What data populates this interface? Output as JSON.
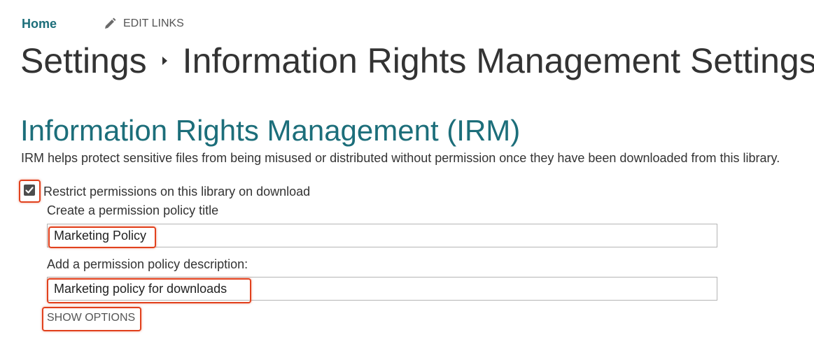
{
  "nav": {
    "home_label": "Home",
    "edit_links_label": "EDIT LINKS"
  },
  "page": {
    "breadcrumb_parent": "Settings",
    "breadcrumb_current": "Information Rights Management Settings"
  },
  "irm": {
    "section_title": "Information Rights Management (IRM)",
    "description": "IRM helps protect sensitive files from being misused or distributed without permission once they have been downloaded from this library.",
    "restrict_checkbox_label": "Restrict permissions on this library on download",
    "restrict_checked": true,
    "policy_title_label": "Create a permission policy title",
    "policy_title_value": "Marketing Policy",
    "policy_description_label": "Add a permission policy description:",
    "policy_description_value": "Marketing policy for downloads",
    "show_options_label": "SHOW OPTIONS"
  },
  "colors": {
    "accent": "#1c6e7a",
    "highlight": "#e1411d",
    "text": "#333333"
  },
  "icons": {
    "edit": "pencil-icon",
    "breadcrumb_separator": "chevron-right-icon",
    "checkbox_mark": "checkmark-icon"
  }
}
